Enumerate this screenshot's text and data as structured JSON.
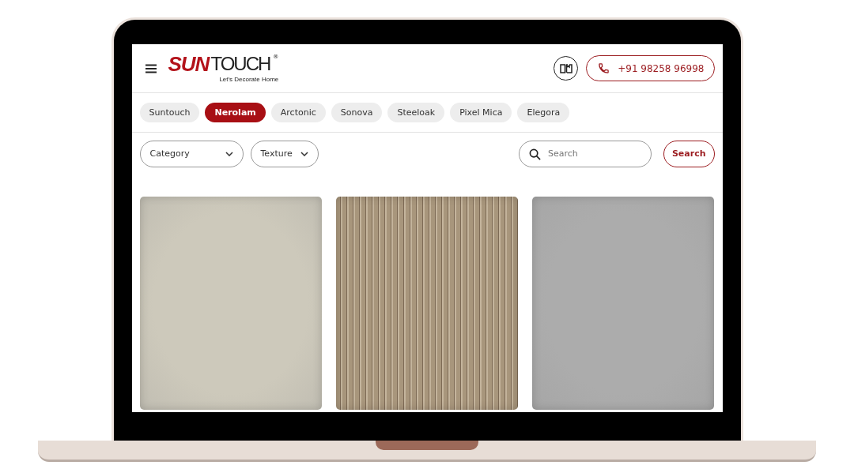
{
  "header": {
    "logo": {
      "mark": "SUN",
      "word": "TOUCH",
      "registered": "®",
      "tagline": "Let's Decorate Home"
    },
    "phone": "+91 98258 96998"
  },
  "brands": [
    {
      "label": "Suntouch",
      "selected": false
    },
    {
      "label": "Nerolam",
      "selected": true
    },
    {
      "label": "Arctonic",
      "selected": false
    },
    {
      "label": "Sonova",
      "selected": false
    },
    {
      "label": "Steeloak",
      "selected": false
    },
    {
      "label": "Pixel Mica",
      "selected": false
    },
    {
      "label": "Elegora",
      "selected": false
    }
  ],
  "filters": [
    {
      "label": "Category"
    },
    {
      "label": "Texture"
    }
  ],
  "search": {
    "placeholder": "Search",
    "button": "Search"
  },
  "products": [
    {
      "kind": "plain",
      "color": "#cdc9bb"
    },
    {
      "kind": "striped",
      "color": "#a8967c"
    },
    {
      "kind": "plain",
      "color": "#acacac"
    }
  ]
}
